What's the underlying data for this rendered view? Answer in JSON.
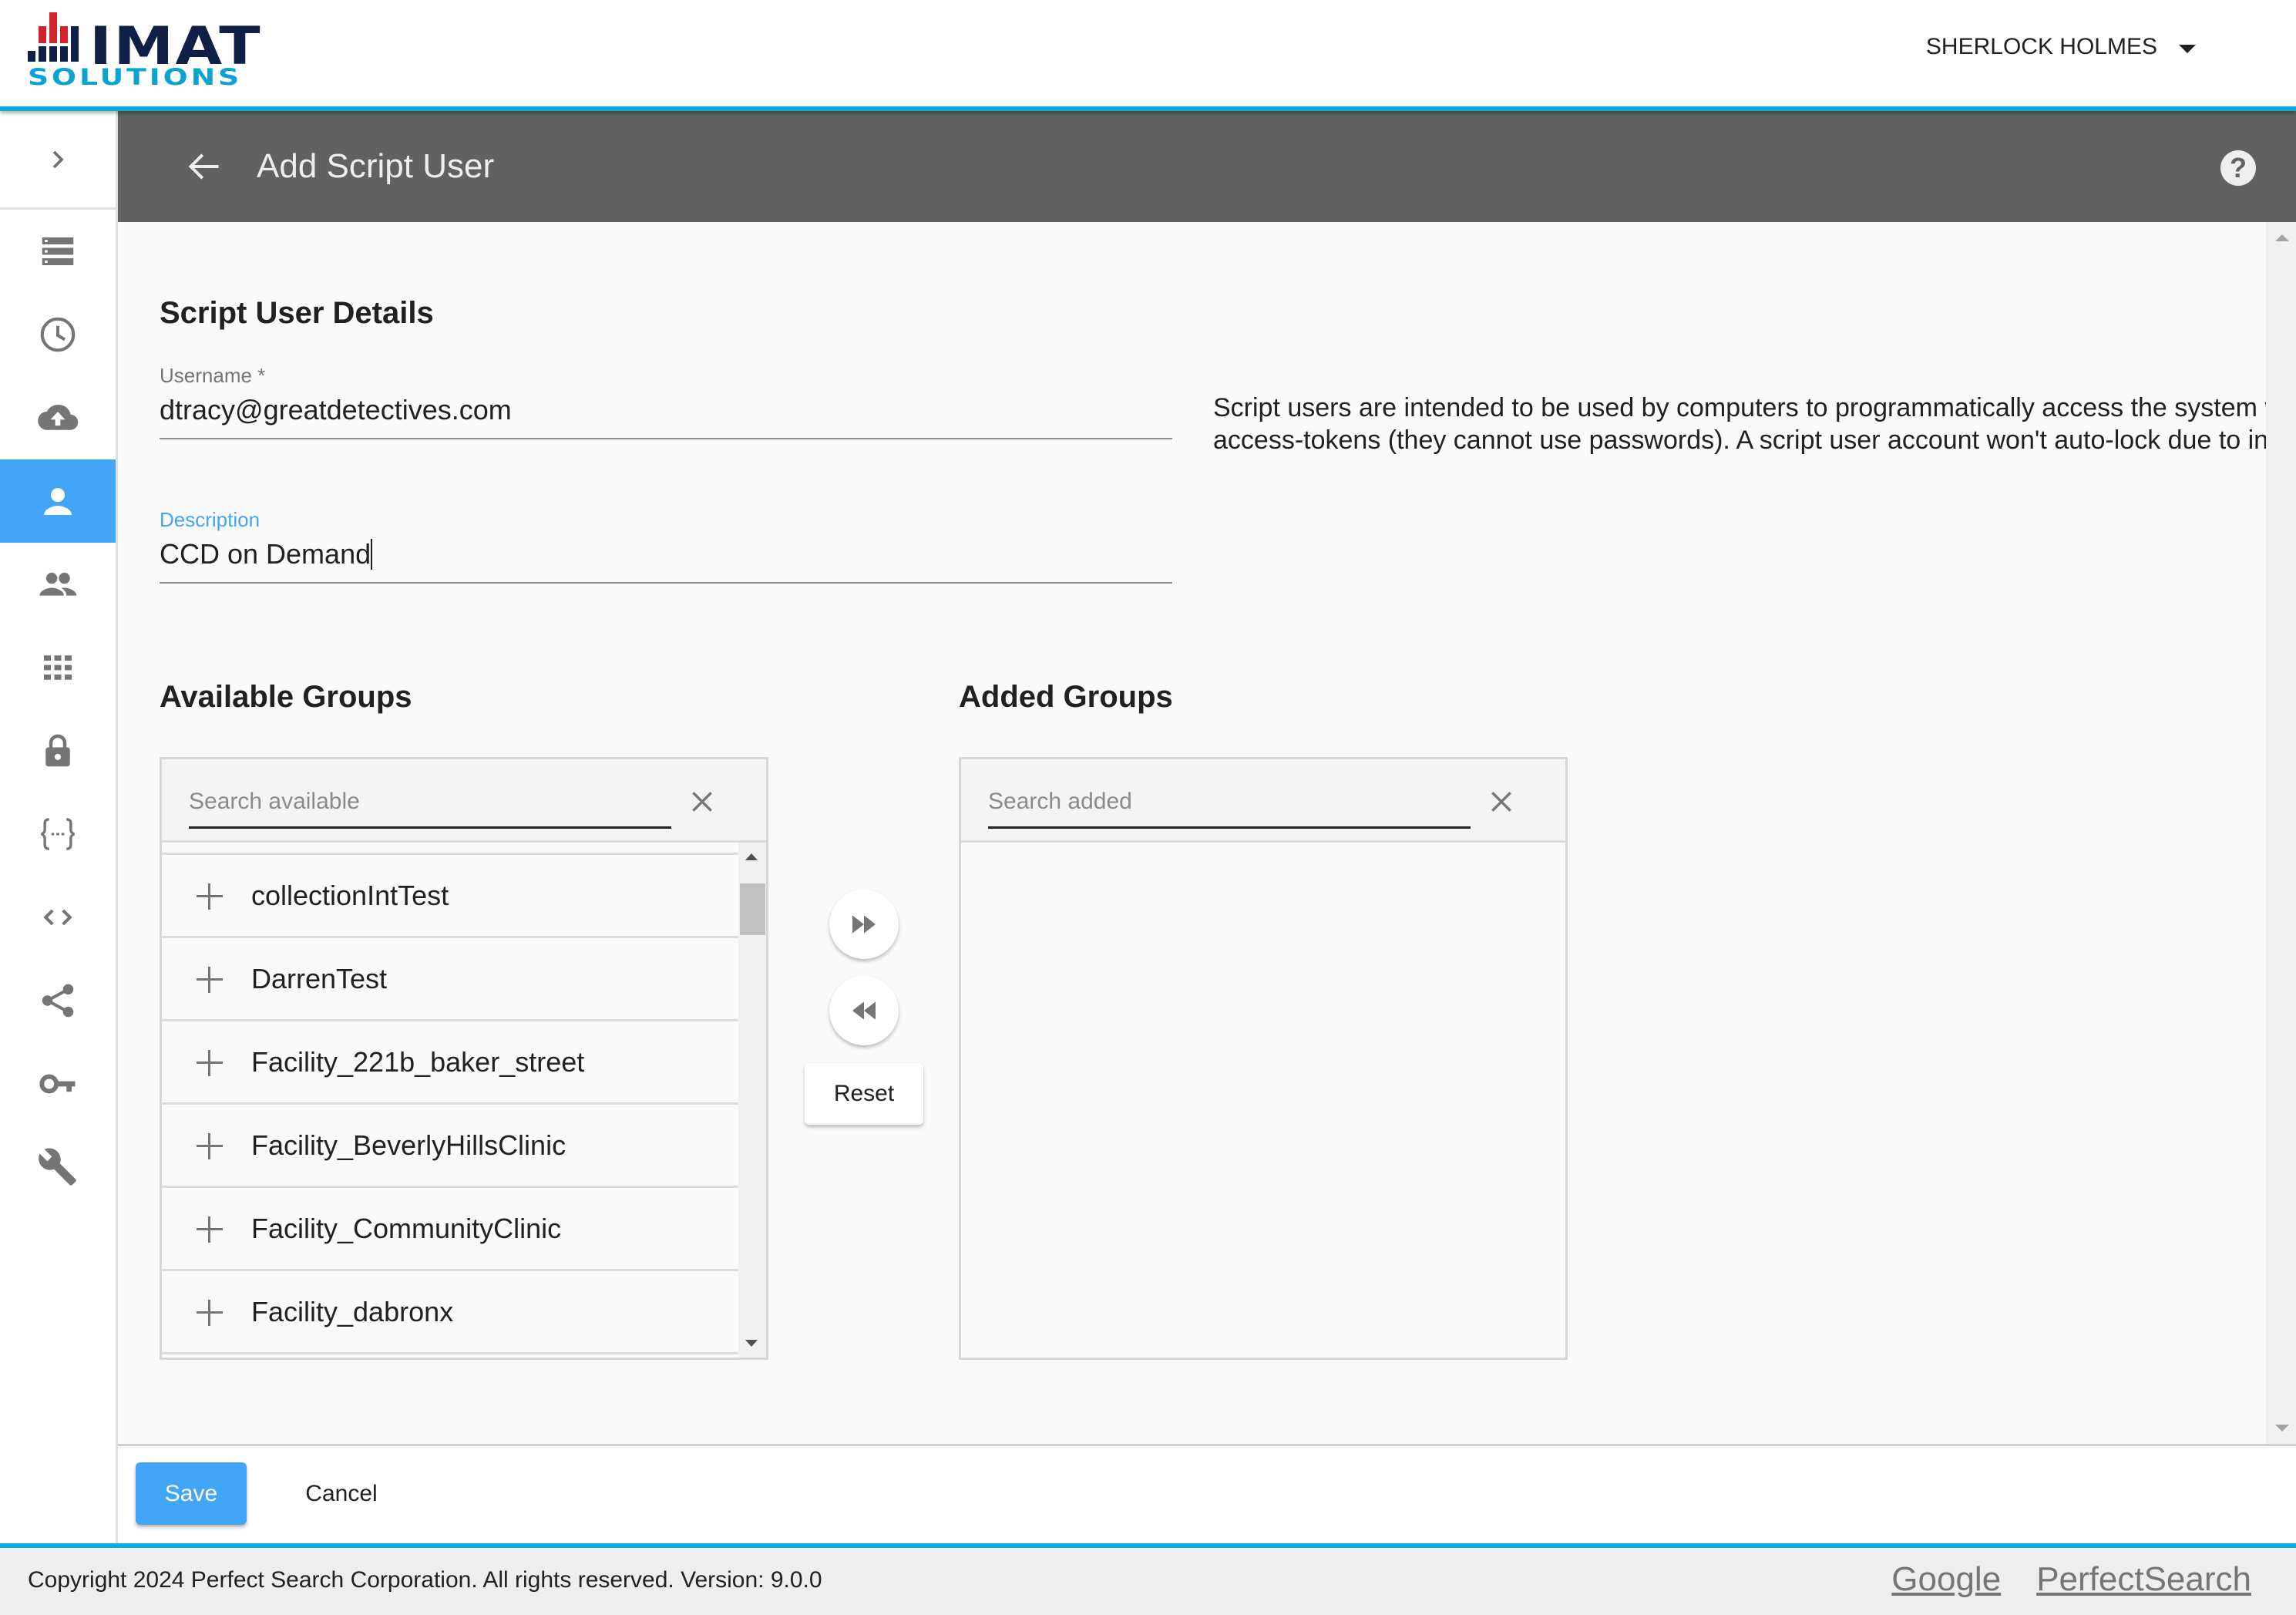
{
  "app": {
    "logo": {
      "top": "IMAT",
      "bottom": "SOLUTIONS"
    },
    "user_menu": {
      "name": "SHERLOCK HOLMES",
      "icon": "caret-down-icon"
    }
  },
  "sidebar": {
    "toggle_icon": "chevron-right-icon",
    "items": [
      {
        "name": "list",
        "icon": "list-icon",
        "active": false
      },
      {
        "name": "history",
        "icon": "clock-icon",
        "active": false
      },
      {
        "name": "upload",
        "icon": "cloud-upload-icon",
        "active": false
      },
      {
        "name": "user",
        "icon": "person-icon",
        "active": true
      },
      {
        "name": "groups",
        "icon": "people-icon",
        "active": false
      },
      {
        "name": "apps",
        "icon": "apps-grid-icon",
        "active": false
      },
      {
        "name": "security",
        "icon": "lock-icon",
        "active": false
      },
      {
        "name": "json",
        "icon": "curly-braces-icon",
        "active": false
      },
      {
        "name": "code",
        "icon": "code-icon",
        "active": false
      },
      {
        "name": "share",
        "icon": "share-icon",
        "active": false
      },
      {
        "name": "keys",
        "icon": "key-icon",
        "active": false
      },
      {
        "name": "tools",
        "icon": "wrench-icon",
        "active": false
      }
    ]
  },
  "page_header": {
    "back_icon": "arrow-left-icon",
    "title": "Add Script User",
    "help_icon": "help-circle-icon",
    "help_glyph": "?"
  },
  "form": {
    "section_title": "Script User Details",
    "username": {
      "label": "Username *",
      "value": "dtracy@greatdetectives.com"
    },
    "description": {
      "label": "Description",
      "value": "CCD on Demand",
      "focused": true
    },
    "info_text": "Script users are intended to be used by computers to programmatically access the system via access-tokens (they cannot use passwords). A script user account won't auto-lock due to inactivity."
  },
  "groups": {
    "available": {
      "title": "Available Groups",
      "search_placeholder": "Search available",
      "search_value": "",
      "items": [
        "collectionIntTest",
        "DarrenTest",
        "Facility_221b_baker_street",
        "Facility_BeverlyHillsClinic",
        "Facility_CommunityClinic",
        "Facility_dabronx"
      ]
    },
    "added": {
      "title": "Added Groups",
      "search_placeholder": "Search added",
      "search_value": "",
      "items": []
    },
    "transfer": {
      "add_all_icon": "fast-forward-icon",
      "remove_all_icon": "rewind-icon",
      "reset_label": "Reset"
    }
  },
  "actions": {
    "save_label": "Save",
    "cancel_label": "Cancel"
  },
  "footer": {
    "copyright": "Copyright 2024 Perfect Search Corporation. All rights reserved. Version: 9.0.0",
    "links": [
      "Google",
      "PerfectSearch"
    ]
  },
  "colors": {
    "accent": "#42a5f5",
    "brand_line": "#0aace0",
    "header_bg": "#616161",
    "logo_navy": "#0f1f45",
    "logo_red": "#d2232a",
    "logo_cyan": "#0aa3d2"
  }
}
